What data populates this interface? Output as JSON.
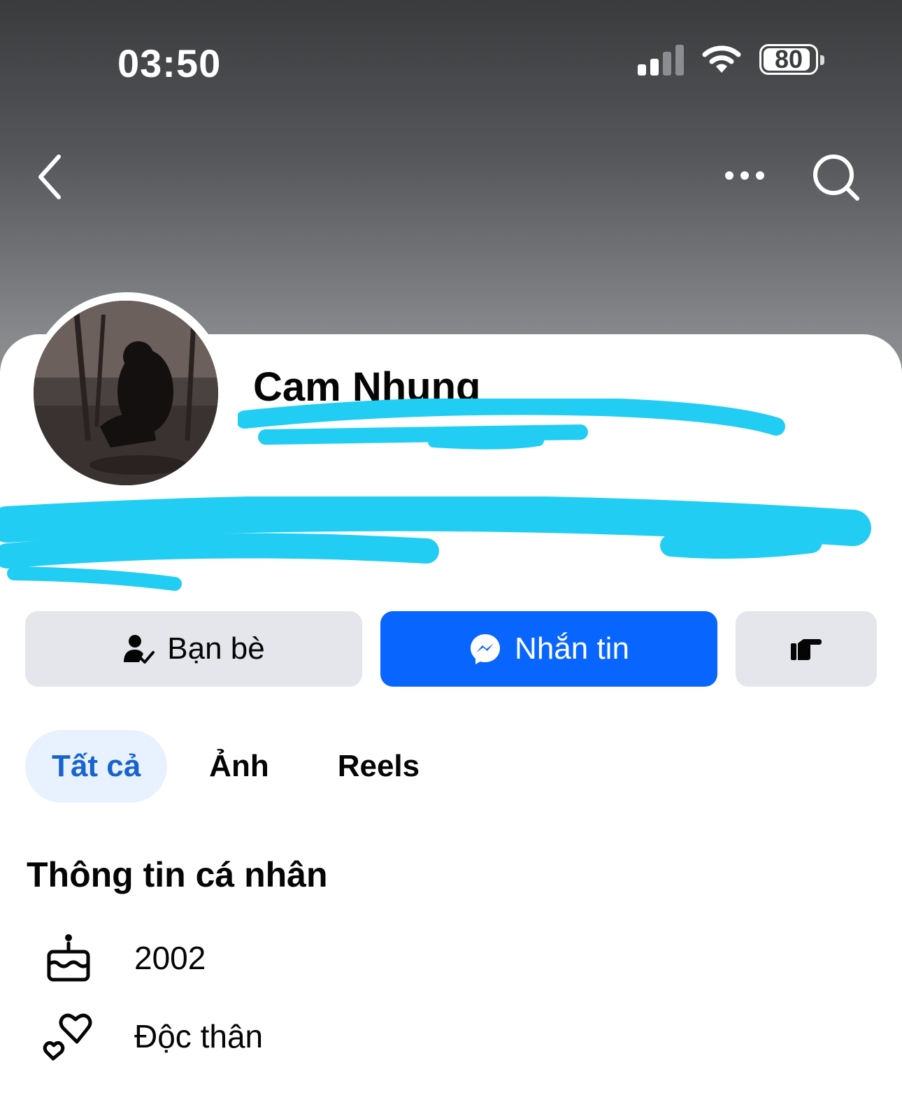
{
  "status_bar": {
    "time": "03:50",
    "battery": "80",
    "icons": [
      "cellular-signal-icon",
      "wifi-icon",
      "battery-icon"
    ]
  },
  "nav": {
    "icons": [
      "back-chevron-icon",
      "more-dots-icon",
      "search-icon"
    ]
  },
  "profile": {
    "name": "Cam Nhung"
  },
  "actions": {
    "friends_label": "Bạn bè",
    "message_label": "Nhắn tin",
    "friends_icon": "friend-check-icon",
    "message_icon": "messenger-icon",
    "poke_icon": "poke-hand-icon"
  },
  "tabs": [
    {
      "label": "Tất cả",
      "active": true
    },
    {
      "label": "Ảnh",
      "active": false
    },
    {
      "label": "Reels",
      "active": false
    }
  ],
  "personal_info": {
    "title": "Thông tin cá nhân",
    "items": [
      {
        "icon": "birthday-cake-icon",
        "text": "2002"
      },
      {
        "icon": "relationship-hearts-icon",
        "text": "Độc thân"
      }
    ]
  },
  "colors": {
    "accent": "#0866ff",
    "active_tab_text": "#1763cf",
    "active_tab_bg": "#e8f2ff",
    "redaction": "#22cdf3",
    "button_gray": "#e4e6eb"
  }
}
